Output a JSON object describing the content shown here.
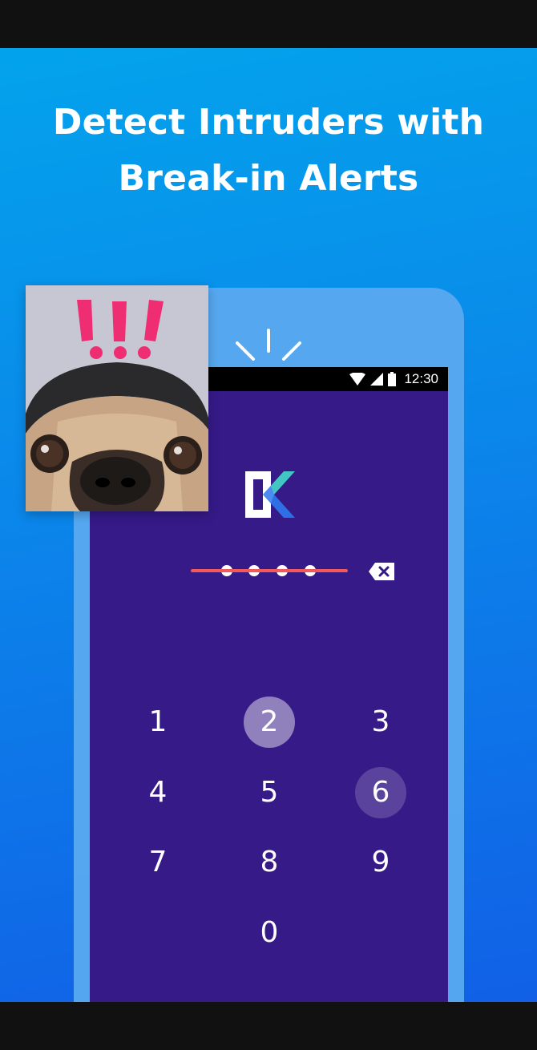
{
  "headline": {
    "line1": "Detect Intruders with",
    "line2": "Break-in Alerts"
  },
  "status_bar": {
    "time": "12:30",
    "icons": [
      "wifi-icon",
      "signal-icon",
      "battery-icon"
    ]
  },
  "app_logo": "keepsafe-k-logo",
  "pin": {
    "entered_digits": 4,
    "state": "incorrect"
  },
  "keypad": {
    "keys": [
      "1",
      "2",
      "3",
      "4",
      "5",
      "6",
      "7",
      "8",
      "9",
      "0"
    ],
    "highlighted": [
      "2",
      "6"
    ]
  },
  "photo": {
    "subject": "pug-intruder-photo",
    "marks": "!!!"
  },
  "colors": {
    "background_top": "#03a3ec",
    "background_bottom": "#1160e6",
    "phone_frame": "#5aaaf0",
    "screen": "#351a88",
    "strike": "#f25a5a",
    "exclaim": "#ee2d72"
  }
}
